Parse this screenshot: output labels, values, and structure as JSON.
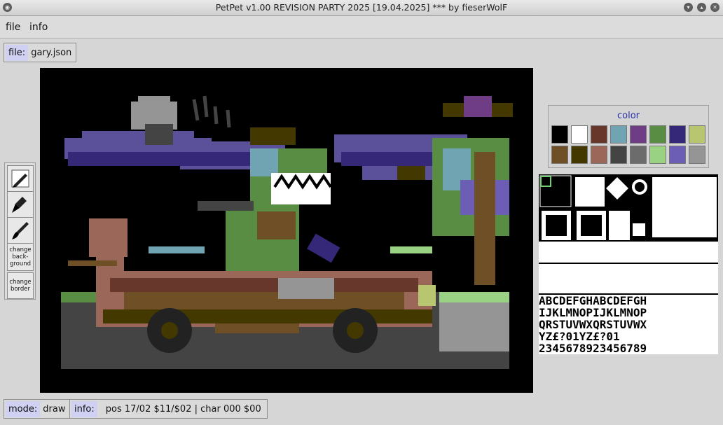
{
  "window": {
    "title": "PetPet v1.00 REVISION PARTY 2025 [19.04.2025] *** by fieserWolF"
  },
  "menu": {
    "file": "file",
    "info": "info"
  },
  "file_box": {
    "label": "file:",
    "value": "gary.json"
  },
  "tools": {
    "draw_icon": "pencil-icon",
    "fill_icon": "bucket-icon",
    "brush_icon": "brush-icon",
    "change_background": [
      "change",
      "back-",
      "ground"
    ],
    "change_border": [
      "change",
      "border"
    ]
  },
  "color_panel": {
    "title": "color",
    "colors": [
      "#000000",
      "#ffffff",
      "#68372b",
      "#70a4b2",
      "#6f3d86",
      "#588d43",
      "#352879",
      "#b8c76f",
      "#6f4f25",
      "#433900",
      "#9a6759",
      "#444444",
      "#6c6c6c",
      "#9ad284",
      "#6c5eb5",
      "#959595"
    ]
  },
  "status": {
    "mode_label": "mode:",
    "mode_value": "draw",
    "info_label": "info:",
    "info_value": "pos 17/02 $11/$02 | char 000 $00"
  },
  "charset_rows": [
    "ABCDEFGHABCDEFGH",
    "IJKLMNOPIJKLMNOP",
    "QRSTUVWXQRSTUVWX",
    "YZ£?01YZ£?01",
    "2345678923456789"
  ]
}
